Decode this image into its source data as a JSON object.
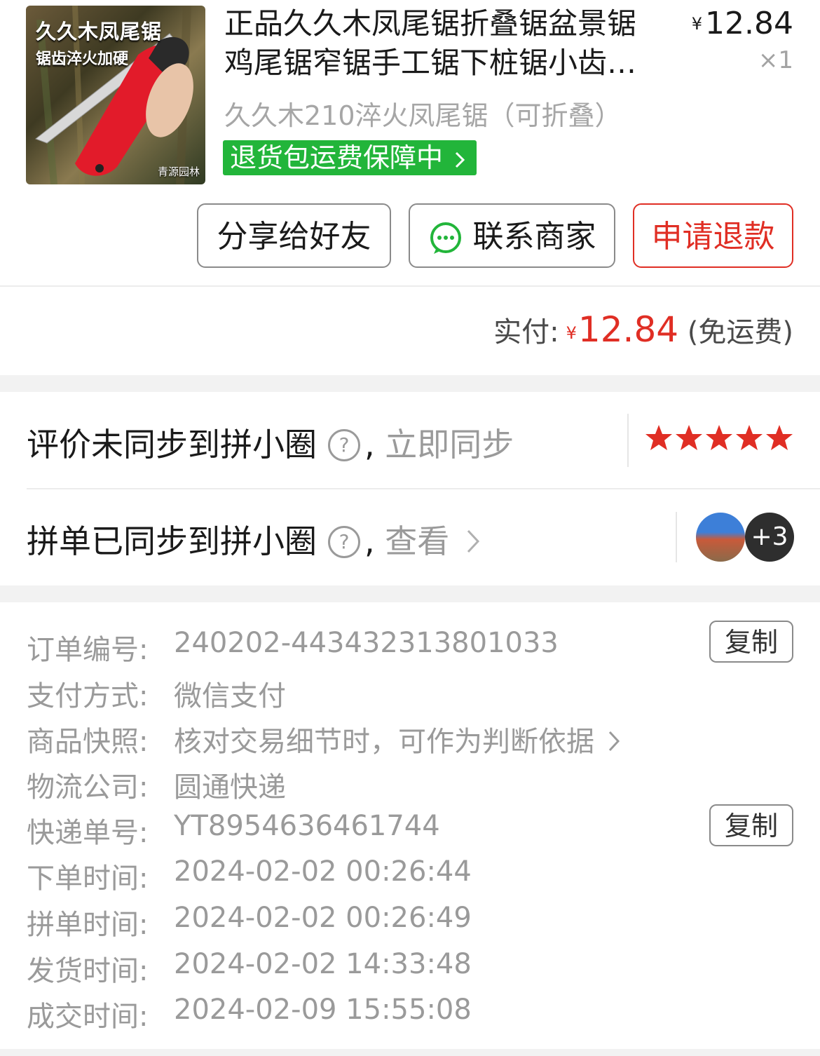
{
  "product": {
    "image_text_1": "久久木凤尾锯",
    "image_text_2": "锯齿淬火加硬",
    "image_watermark": "青源园林",
    "title_line1": "正品久久木凤尾锯折叠锯盆景锯",
    "title_line2": "鸡尾锯窄锯手工锯下桩锯小齿…",
    "price_symbol": "¥",
    "price": "12.84",
    "quantity": "×1",
    "spec": "久久木210淬火凤尾锯（可折叠）",
    "badge": "退货包运费保障中"
  },
  "actions": {
    "share": "分享给好友",
    "contact": "联系商家",
    "refund": "申请退款"
  },
  "payment": {
    "label": "实付:",
    "symbol": "¥",
    "amount": "12.84",
    "note": "(免运费)"
  },
  "sync": {
    "review_text": "评价未同步到拼小圈",
    "review_link": "立即同步",
    "review_stars": 5,
    "order_text": "拼单已同步到拼小圈",
    "order_link": "查看",
    "more_count": "+3"
  },
  "info": {
    "order_no_label": "订单编号:",
    "order_no": "240202-443432313801033",
    "copy_label": "复制",
    "pay_method_label": "支付方式:",
    "pay_method": "微信支付",
    "snapshot_label": "商品快照:",
    "snapshot": "核对交易细节时，可作为判断依据",
    "logistics_label": "物流公司:",
    "logistics": "圆通快递",
    "tracking_label": "快递单号:",
    "tracking": "YT8954636461744",
    "order_time_label": "下单时间:",
    "order_time": "2024-02-02 00:26:44",
    "group_time_label": "拼单时间:",
    "group_time": "2024-02-02 00:26:49",
    "ship_time_label": "发货时间:",
    "ship_time": "2024-02-02 14:33:48",
    "deal_time_label": "成交时间:",
    "deal_time": "2024-02-09 15:55:08"
  },
  "colors": {
    "accent_red": "#e02e24",
    "badge_green": "#22b53a"
  }
}
